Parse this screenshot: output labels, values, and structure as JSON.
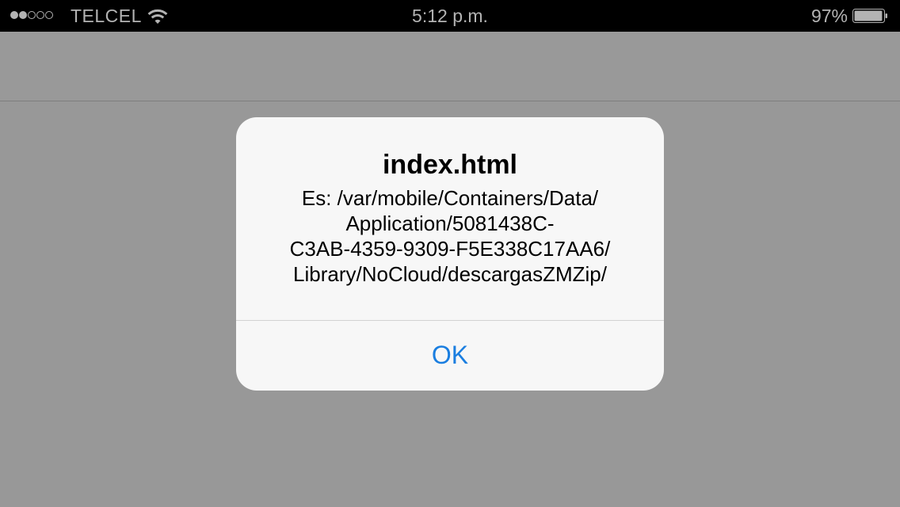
{
  "status_bar": {
    "signal_strength": "2 of 5",
    "carrier": "TELCEL",
    "time": "5:12 p.m.",
    "battery_percent": "97%",
    "battery_level": 0.97,
    "icons": [
      "signal-dots-icon",
      "wifi-icon",
      "battery-icon"
    ]
  },
  "alert": {
    "title": "index.html",
    "message_lines": [
      "Es: /var/mobile/Containers/Data/",
      "Application/5081438C-",
      "C3AB-4359-9309-F5E338C17AA6/",
      "Library/NoCloud/descargasZMZip/"
    ],
    "ok_label": "OK"
  },
  "colors": {
    "status_bar_bg": "#000000",
    "status_text": "#b3b3b3",
    "dim_background": "#989898",
    "alert_bg": "#f7f7f7",
    "ok_blue": "#1a7ee0"
  }
}
